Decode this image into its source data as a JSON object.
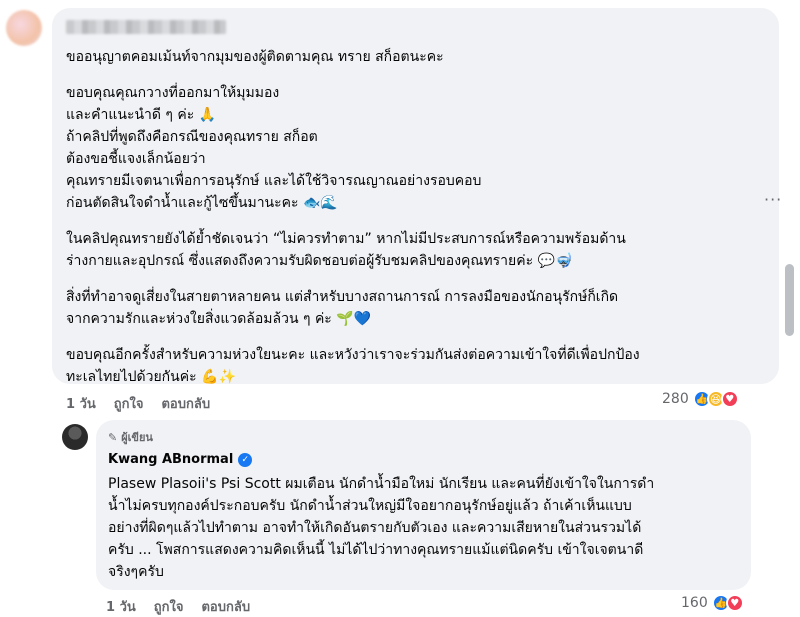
{
  "comment": {
    "paragraphs": [
      [
        "ขออนุญาตคอมเม้นท์จากมุมของผู้ติดตามคุณ ทราย สก็อตนะคะ"
      ],
      [
        "ขอบคุณคุณกวางที่ออกมาให้มุมมอง",
        "และคำแนะนำดี ๆ ค่ะ 🙏",
        "ถ้าคลิปที่พูดถึงคือกรณีของคุณทราย สก็อต",
        "ต้องขอชี้แจงเล็กน้อยว่า",
        "คุณทรายมีเจตนาเพื่อการอนุรักษ์ และได้ใช้วิจารณญาณอย่างรอบคอบ",
        "ก่อนตัดสินใจดำน้ำและกู้ไซขึ้นมานะคะ 🐟🌊"
      ],
      [
        "ในคลิปคุณทรายยังได้ย้ำชัดเจนว่า “ไม่ควรทำตาม” หากไม่มีประสบการณ์หรือความพร้อมด้าน",
        "ร่างกายและอุปกรณ์ ซึ่งแสดงถึงความรับผิดชอบต่อผู้รับชมคลิปของคุณทรายค่ะ 💬🤿"
      ],
      [
        "สิ่งที่ทำอาจดูเสี่ยงในสายตาหลายคน แต่สำหรับบางสถานการณ์ การลงมือของนักอนุรักษ์ก็เกิด",
        "จากความรักและห่วงใยสิ่งแวดล้อมล้วน ๆ ค่ะ 🌱💙"
      ],
      [
        "ขอบคุณอีกครั้งสำหรับความห่วงใยนะคะ และหวังว่าเราจะร่วมกันส่งต่อความเข้าใจที่ดีเพื่อปกป้อง",
        "ทะเลไทยไปด้วยกันค่ะ 💪✨"
      ]
    ],
    "time": "1 วัน",
    "like_label": "ถูกใจ",
    "reply_label": "ตอบกลับ",
    "reaction_count": "280"
  },
  "reply": {
    "badge": "ผู้เขียน",
    "author": "Kwang ABnormal",
    "lines": [
      "Plasew Plasoii's Psi Scott ผมเตือน นักดำน้ำมือใหม่ นักเรียน และคนที่ยังเข้าใจในการดำ",
      "น้ำไม่ครบทุกองค์ประกอบครับ นักดำน้ำส่วนใหญ่มีใจอยากอนุรักษ์อยู่แล้ว ถ้าเค้าเห็นแบบ",
      "อย่างที่ผิดๆแล้วไปทำตาม อาจทำให้เกิดอันตรายกับตัวเอง และความเสียหายในส่วนรวมได้",
      "ครับ ... โพสการแสดงความคิดเห็นนี้ ไม่ได้ไปว่าทางคุณทรายแม้แต่นิดครับ เข้าใจเจตนาดี",
      "จริงๆครับ"
    ],
    "time": "1 วัน",
    "like_label": "ถูกใจ",
    "reply_label": "ตอบกลับ",
    "reaction_count": "160"
  },
  "icons": {
    "more": "more-options-icon",
    "pen": "pen-icon",
    "verified": "verified-badge-icon",
    "like": "like-reaction-icon",
    "haha": "haha-reaction-icon",
    "love": "love-reaction-icon"
  },
  "colors": {
    "bubble": "#f0f2f5",
    "meta_text": "#65676b",
    "like_blue": "#1877f2",
    "love_red": "#f33e58",
    "haha_yellow": "#f7b928"
  }
}
